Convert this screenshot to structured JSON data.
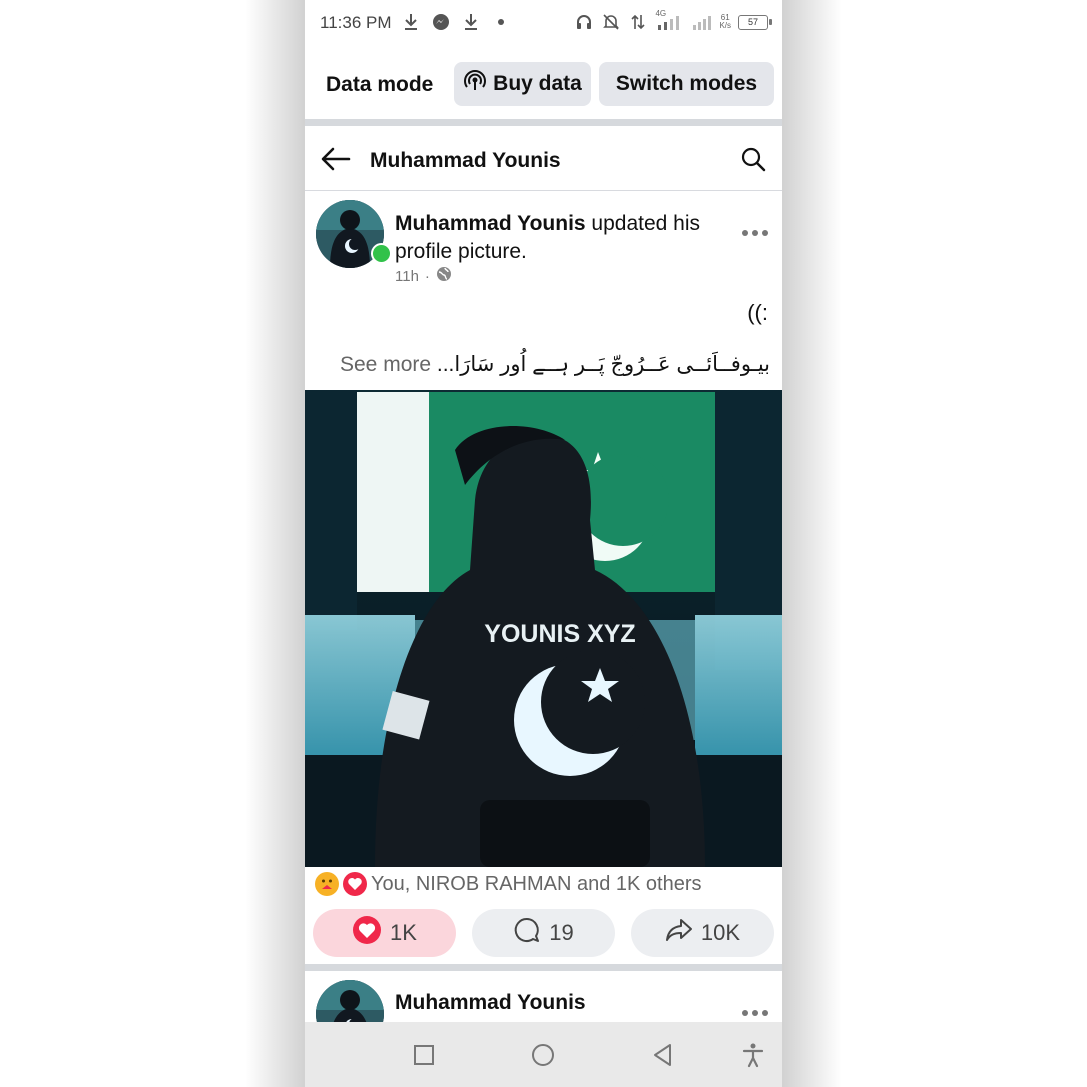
{
  "status_bar": {
    "time": "11:36 PM",
    "network_type": "4G",
    "speed_value": "61",
    "speed_unit": "K/s",
    "battery": "57",
    "left_icons": [
      "download-icon",
      "messenger-icon",
      "download-icon",
      "dot-icon"
    ],
    "right_icons": [
      "headset-icon",
      "bell-off-icon",
      "data-arrows-icon",
      "signal-icon",
      "signal-icon",
      "battery-icon"
    ]
  },
  "data_bar": {
    "label": "Data mode",
    "buy_label": "Buy data",
    "switch_label": "Switch modes"
  },
  "header": {
    "title": "Muhammad Younis"
  },
  "post": {
    "author": "Muhammad Younis",
    "action_text": " updated his profile picture.",
    "time": "11h",
    "visibility_icon": "globe-icon",
    "caption_line1": "((:",
    "caption_line2": "بیـوفــاَئــی عَــرُوجّ پَــر ہــے اُور سَارَا...",
    "see_more": "See more",
    "image_text": "YOUNIS XYZ",
    "reactions_text": "You, NIROB RAHMAN and 1K others",
    "reaction_icons": [
      "care-emoji-icon",
      "love-emoji-icon"
    ],
    "like_count": "1K",
    "comment_count": "19",
    "share_count": "10K"
  },
  "post2": {
    "author": "Muhammad Younis"
  },
  "colors": {
    "online": "#31c24a",
    "like_bg": "#fbd6dc",
    "love_red": "#f0284a",
    "button_bg": "#e4e6eb"
  },
  "nav": [
    "square-icon",
    "circle-icon",
    "back-triangle-icon",
    "accessibility-icon"
  ]
}
